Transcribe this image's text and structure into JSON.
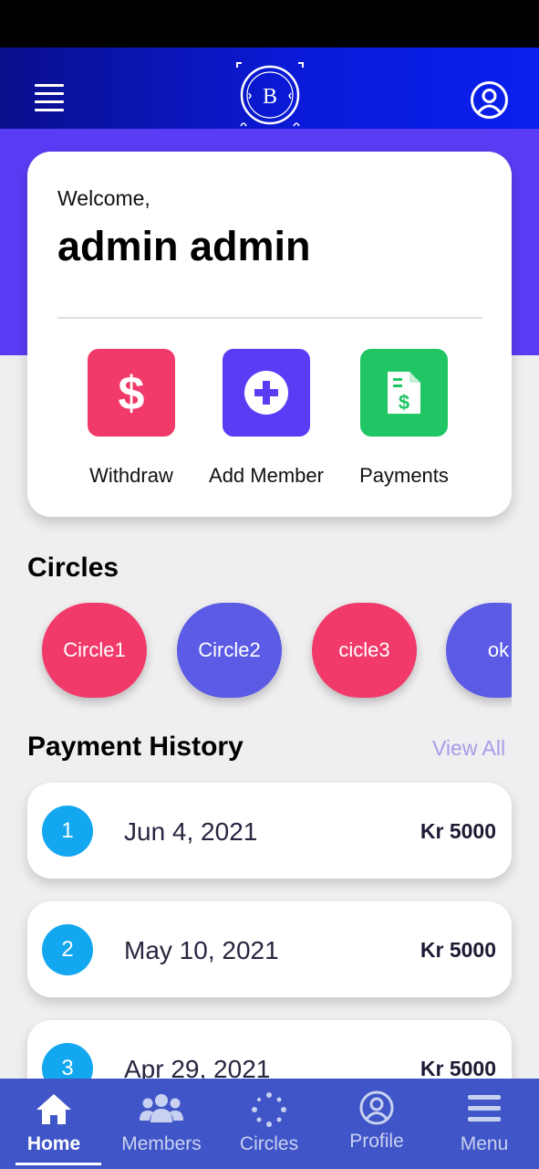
{
  "colors": {
    "app_bar": "#0a1ad8",
    "hero": "#5b3cf5",
    "withdraw": "#f23a6a",
    "add_member": "#5b3cf5",
    "payments": "#1fc663",
    "bottom_nav": "#3f55c8",
    "badge": "#13a7ef"
  },
  "header": {
    "menu_icon": "hamburger-icon",
    "logo_letter": "B",
    "profile_icon": "user-circle-icon"
  },
  "welcome": {
    "label": "Welcome,",
    "name": "admin admin"
  },
  "actions": [
    {
      "label": "Withdraw",
      "icon": "dollar-icon",
      "color": "#f23a6a"
    },
    {
      "label": "Add Member",
      "icon": "plus-circle-icon",
      "color": "#5b3cf5"
    },
    {
      "label": "Payments",
      "icon": "invoice-icon",
      "color": "#1fc663"
    }
  ],
  "circles": {
    "title": "Circles",
    "items": [
      {
        "label": "Circle1",
        "color": "#f23a6a"
      },
      {
        "label": "Circle2",
        "color": "#5b5be6"
      },
      {
        "label": "cicle3",
        "color": "#f23a6a"
      },
      {
        "label": "ok",
        "color": "#5b5be6"
      }
    ]
  },
  "payment_history": {
    "title": "Payment History",
    "view_all": "View All",
    "items": [
      {
        "index": "1",
        "date": "Jun 4, 2021",
        "amount": "Kr 5000"
      },
      {
        "index": "2",
        "date": "May 10, 2021",
        "amount": "Kr 5000"
      },
      {
        "index": "3",
        "date": "Apr 29, 2021",
        "amount": "Kr 5000"
      }
    ]
  },
  "bottom_nav": [
    {
      "label": "Home",
      "icon": "home-icon",
      "active": true
    },
    {
      "label": "Members",
      "icon": "users-icon",
      "active": false
    },
    {
      "label": "Circles",
      "icon": "dots-circle-icon",
      "active": false
    },
    {
      "label": "Profile",
      "icon": "user-circle-icon",
      "active": false
    },
    {
      "label": "Menu",
      "icon": "menu-icon",
      "active": false
    }
  ]
}
